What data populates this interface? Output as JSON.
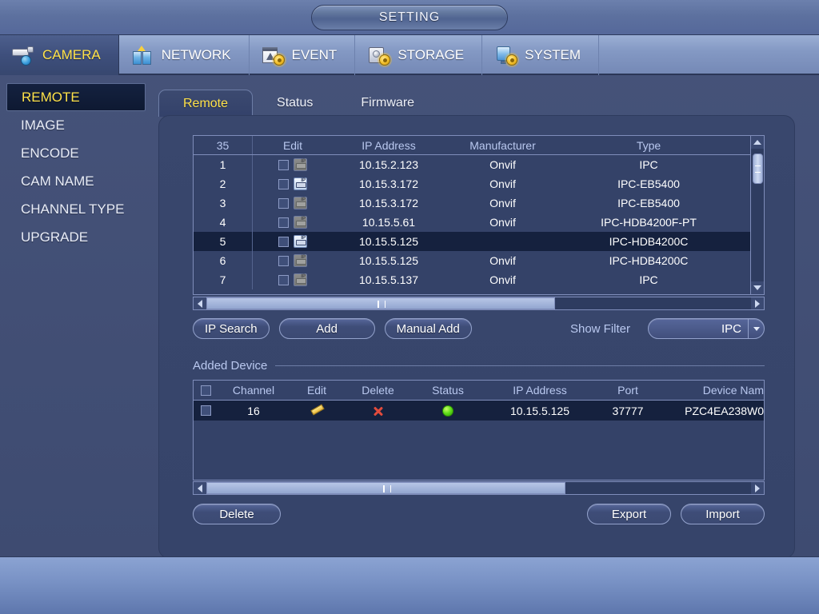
{
  "window": {
    "title": "SETTING"
  },
  "topnav": {
    "items": [
      {
        "label": "CAMERA",
        "icon": "camera-icon",
        "active": true
      },
      {
        "label": "NETWORK",
        "icon": "network-icon",
        "active": false
      },
      {
        "label": "EVENT",
        "icon": "event-icon",
        "active": false
      },
      {
        "label": "STORAGE",
        "icon": "storage-icon",
        "active": false
      },
      {
        "label": "SYSTEM",
        "icon": "system-icon",
        "active": false
      }
    ]
  },
  "sidebar": {
    "items": [
      {
        "label": "REMOTE",
        "active": true
      },
      {
        "label": "IMAGE",
        "active": false
      },
      {
        "label": "ENCODE",
        "active": false
      },
      {
        "label": "CAM NAME",
        "active": false
      },
      {
        "label": "CHANNEL TYPE",
        "active": false
      },
      {
        "label": "UPGRADE",
        "active": false
      }
    ]
  },
  "tabs": [
    {
      "label": "Remote",
      "active": true
    },
    {
      "label": "Status",
      "active": false
    },
    {
      "label": "Firmware",
      "active": false
    }
  ],
  "discovery": {
    "count_label": "35",
    "headers": [
      "35",
      "Edit",
      "IP Address",
      "Manufacturer",
      "Type"
    ],
    "rows": [
      {
        "num": "1",
        "edit_enabled": false,
        "ip": "10.15.2.123",
        "manufacturer": "Onvif",
        "type": "IPC",
        "selected": false
      },
      {
        "num": "2",
        "edit_enabled": true,
        "ip": "10.15.3.172",
        "manufacturer": "Onvif",
        "type": "IPC-EB5400",
        "selected": false
      },
      {
        "num": "3",
        "edit_enabled": false,
        "ip": "10.15.3.172",
        "manufacturer": "Onvif",
        "type": "IPC-EB5400",
        "selected": false
      },
      {
        "num": "4",
        "edit_enabled": false,
        "ip": "10.15.5.61",
        "manufacturer": "Onvif",
        "type": "IPC-HDB4200F-PT",
        "selected": false
      },
      {
        "num": "5",
        "edit_enabled": true,
        "ip": "10.15.5.125",
        "manufacturer": "",
        "type": "IPC-HDB4200C",
        "selected": true
      },
      {
        "num": "6",
        "edit_enabled": false,
        "ip": "10.15.5.125",
        "manufacturer": "Onvif",
        "type": "IPC-HDB4200C",
        "selected": false
      },
      {
        "num": "7",
        "edit_enabled": false,
        "ip": "10.15.5.137",
        "manufacturer": "Onvif",
        "type": "IPC",
        "selected": false
      }
    ]
  },
  "toolbar": {
    "ip_search_label": "IP Search",
    "add_label": "Add",
    "manual_add_label": "Manual Add",
    "show_filter_label": "Show Filter",
    "filter_value": "IPC"
  },
  "added_device": {
    "legend": "Added Device",
    "headers": [
      "Channel",
      "Edit",
      "Delete",
      "Status",
      "IP Address",
      "Port",
      "Device Nam"
    ],
    "rows": [
      {
        "channel": "16",
        "edit_icon": "pencil-icon",
        "delete_icon": "x-icon",
        "status": "online",
        "ip": "10.15.5.125",
        "port": "37777",
        "device_name": "PZC4EA238W0"
      }
    ]
  },
  "footer_buttons": {
    "delete_label": "Delete",
    "export_label": "Export",
    "import_label": "Import"
  },
  "colors": {
    "accent_yellow": "#ffe24a",
    "header_text": "#b9c8ef",
    "panel_bg": "#39476d",
    "selected_row": "#15213e",
    "status_online": "#5ddc18",
    "delete_red": "#e24b3c"
  }
}
